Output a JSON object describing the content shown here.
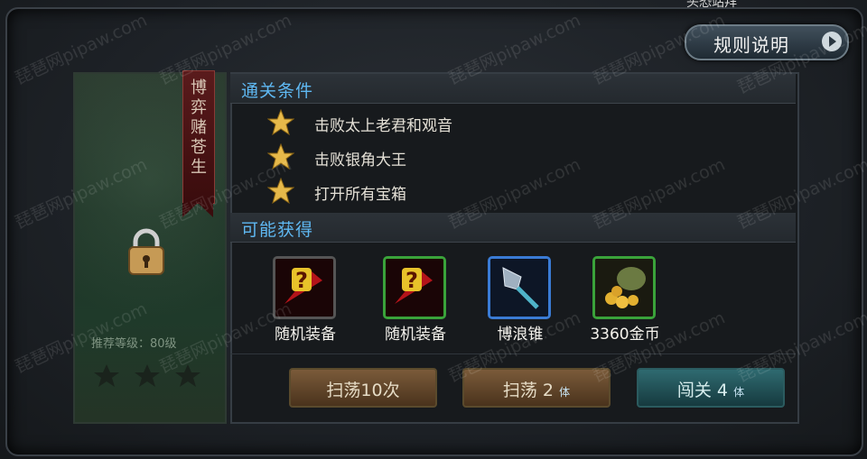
{
  "top_fragment": "头恐站拜",
  "rules_button": {
    "label": "规则说明"
  },
  "stage": {
    "banner_title": "博弈赌苍生",
    "recommended_level": "推荐等级：80级",
    "locked": true
  },
  "conditions": {
    "title": "通关条件",
    "items": [
      "击败太上老君和观音",
      "击败银角大王",
      "打开所有宝箱"
    ]
  },
  "rewards": {
    "title": "可能获得",
    "items": [
      {
        "label": "随机装备",
        "icon": "random-equipment-red-icon",
        "border": "#555555"
      },
      {
        "label": "随机装备",
        "icon": "random-equipment-green-icon",
        "border": "#3aa33a"
      },
      {
        "label": "博浪锥",
        "icon": "spiked-mace-icon",
        "border": "#3a7bd5"
      },
      {
        "label": "3360金币",
        "icon": "gold-coins-bag-icon",
        "border": "#3aa33a"
      }
    ]
  },
  "buttons": {
    "sweep10": "扫荡10次",
    "sweep2": "扫荡 2",
    "fight": "闯关 4",
    "stamina_unit": "体"
  },
  "watermark": "琵琶网pipaw.com",
  "colors": {
    "section_title": "#5fb8f2",
    "sweep_btn": "#6a4a2a",
    "fight_btn": "#2f6a70"
  }
}
